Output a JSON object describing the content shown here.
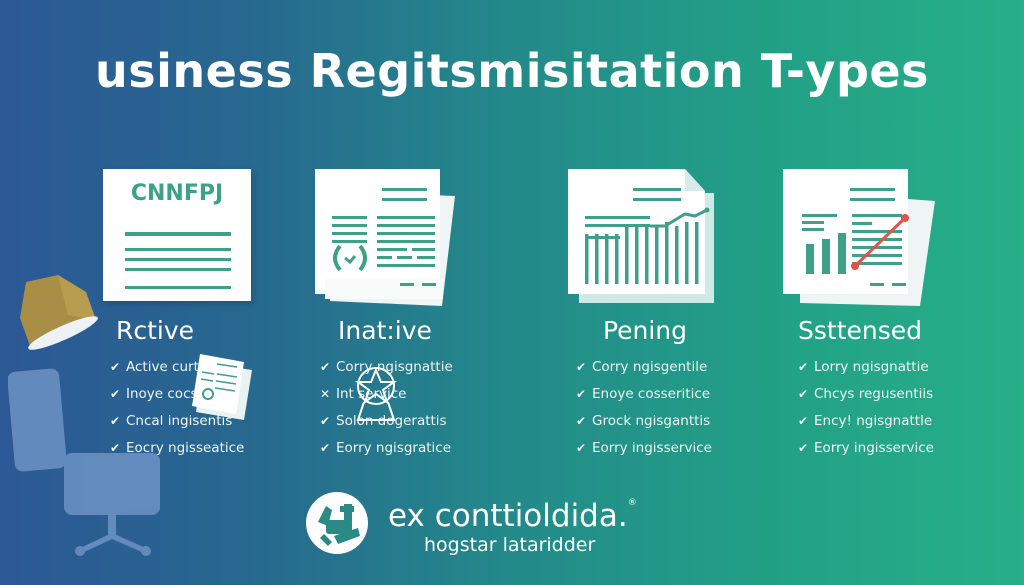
{
  "title": "usiness Regitsmisitation T-ypes",
  "colors": {
    "bg_left": "#2c5895",
    "bg_right": "#27af88",
    "accent_teal": "#3fa08a",
    "accent_red": "#e0524a",
    "lamp_gold": "#a98f45",
    "chair_blue": "#6d93c4"
  },
  "columns": [
    {
      "doc_label": "CNNFPJ",
      "icon": "document-lines-icon",
      "heading": "Rctive",
      "items": [
        {
          "mark": "check",
          "text": "Active curtle"
        },
        {
          "mark": "check",
          "text": "Inoye cocs"
        },
        {
          "mark": "check",
          "text": "Cncal ingisentis"
        },
        {
          "mark": "check",
          "text": "Eocry ngisseatice"
        }
      ]
    },
    {
      "icon": "stamped-document-icon",
      "heading": "Inat:ive",
      "items": [
        {
          "mark": "check",
          "text": "Corry ngisgnattie"
        },
        {
          "mark": "cross",
          "text": "Int   service"
        },
        {
          "mark": "check",
          "text": "Solon dogerattis"
        },
        {
          "mark": "check",
          "text": "Eorry ngisgratice"
        }
      ]
    },
    {
      "icon": "chart-document-icon",
      "heading": "Pening",
      "items": [
        {
          "mark": "check",
          "text": "Corry ngisgentile"
        },
        {
          "mark": "check",
          "text": "Enoye cosseritice"
        },
        {
          "mark": "check",
          "text": "Grock ngisganttis"
        },
        {
          "mark": "check",
          "text": "Eorry ingisservice"
        }
      ]
    },
    {
      "icon": "trend-document-icon",
      "heading": "Ssttensed",
      "items": [
        {
          "mark": "check",
          "text": "Lorry ngisgnattie"
        },
        {
          "mark": "check",
          "text": "Chcys regusentiis"
        },
        {
          "mark": "check",
          "text": "Ency! ngisgnattle"
        },
        {
          "mark": "check",
          "text": "Eorry ingisservice"
        }
      ]
    }
  ],
  "marks": {
    "check": "✔",
    "cross": "✕"
  },
  "brand": {
    "name": "ex conttioldida.",
    "registered": "®",
    "tagline": "hogstar lataridder"
  }
}
